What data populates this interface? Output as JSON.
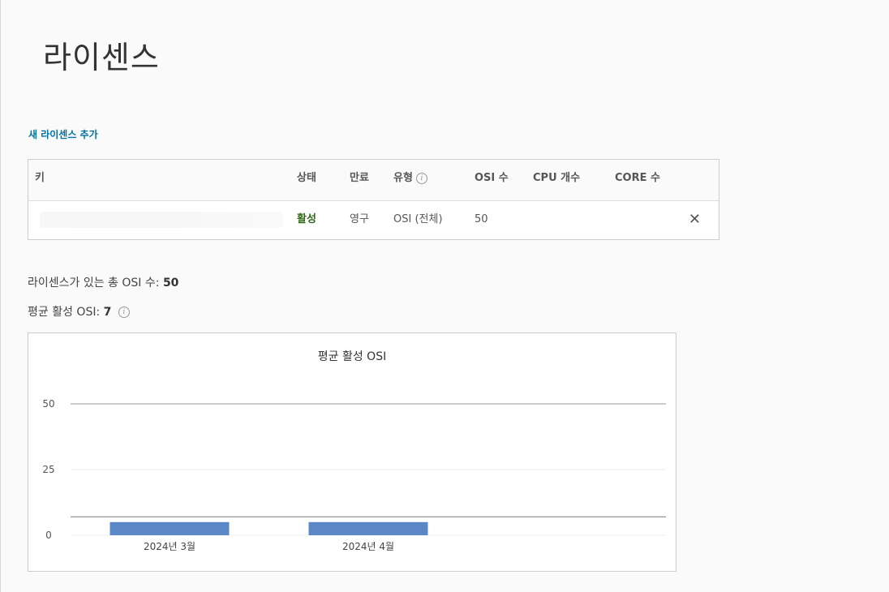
{
  "page": {
    "title": "라이센스"
  },
  "actions": {
    "add_new_license": "새 라이센스 추가"
  },
  "table": {
    "headers": {
      "key": "키",
      "status": "상태",
      "expiration": "만료",
      "type": "유형",
      "osi_count": "OSI 수",
      "cpu_count": "CPU 개수",
      "core_count": "CORE 수"
    },
    "rows": [
      {
        "key": "",
        "status": "활성",
        "expiration": "영구",
        "type": "OSI (전체)",
        "osi_count": "50",
        "cpu_count": "",
        "core_count": ""
      }
    ]
  },
  "summary": {
    "total_label": "라이센스가 있는 총 OSI 수:",
    "total_value": "50",
    "avg_label": "평균 활성 OSI:",
    "avg_value": "7"
  },
  "chart_data": {
    "type": "bar",
    "title": "평균 활성 OSI",
    "categories": [
      "2024년 3월",
      "2024년 4월"
    ],
    "values": [
      5,
      5
    ],
    "reference_lines": [
      50,
      7
    ],
    "ylim": [
      0,
      50
    ],
    "yticks": [
      0,
      25,
      50
    ],
    "xlabel": "",
    "ylabel": "",
    "grid": true,
    "colors": {
      "bar": "#5b87c7",
      "reference": "#888888",
      "grid": "#eeeeee"
    }
  },
  "colors": {
    "link": "#0072a3",
    "active_status": "#2f6a15"
  }
}
